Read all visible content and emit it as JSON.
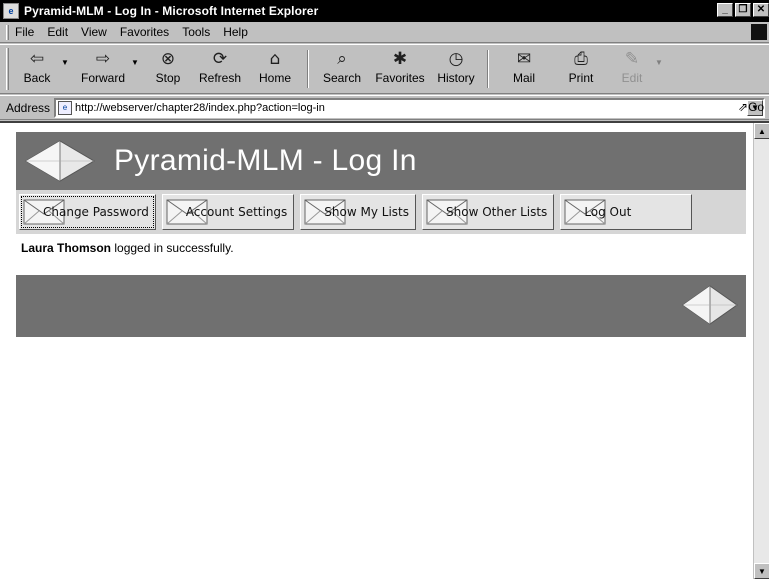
{
  "window": {
    "title": "Pyramid-MLM - Log In - Microsoft Internet Explorer",
    "buttons": {
      "minimize": "_",
      "restore": "❐",
      "close": "✕"
    }
  },
  "menu": {
    "items": [
      "File",
      "Edit",
      "View",
      "Favorites",
      "Tools",
      "Help"
    ]
  },
  "toolbar": {
    "buttons": [
      {
        "label": "Back",
        "icon": "back-arrow-icon",
        "glyph": "⇦"
      },
      {
        "label": "Forward",
        "icon": "forward-arrow-icon",
        "glyph": "⇨"
      },
      {
        "label": "Stop",
        "icon": "stop-icon",
        "glyph": "⊗"
      },
      {
        "label": "Refresh",
        "icon": "refresh-icon",
        "glyph": "⟳"
      },
      {
        "label": "Home",
        "icon": "home-icon",
        "glyph": "⌂"
      },
      {
        "label": "Search",
        "icon": "search-icon",
        "glyph": "⌕"
      },
      {
        "label": "Favorites",
        "icon": "favorites-icon",
        "glyph": "✱"
      },
      {
        "label": "History",
        "icon": "history-icon",
        "glyph": "◷"
      },
      {
        "label": "Mail",
        "icon": "mail-icon",
        "glyph": "✉"
      },
      {
        "label": "Print",
        "icon": "print-icon",
        "glyph": "⎙"
      },
      {
        "label": "Edit",
        "icon": "edit-icon",
        "glyph": "✎"
      }
    ]
  },
  "address": {
    "label": "Address",
    "url": "http://webserver/chapter28/index.php?action=log-in",
    "go_label": "Go"
  },
  "page": {
    "banner_title": "Pyramid-MLM - Log In",
    "nav": [
      "Change Password",
      "Account Settings",
      "Show My Lists",
      "Show Other Lists",
      "Log Out"
    ],
    "message_user": "Laura Thomson",
    "message_text": " logged in successfully."
  },
  "colors": {
    "banner": "#707070",
    "navbar": "#d6d6d6",
    "titlebar": "#000000"
  }
}
